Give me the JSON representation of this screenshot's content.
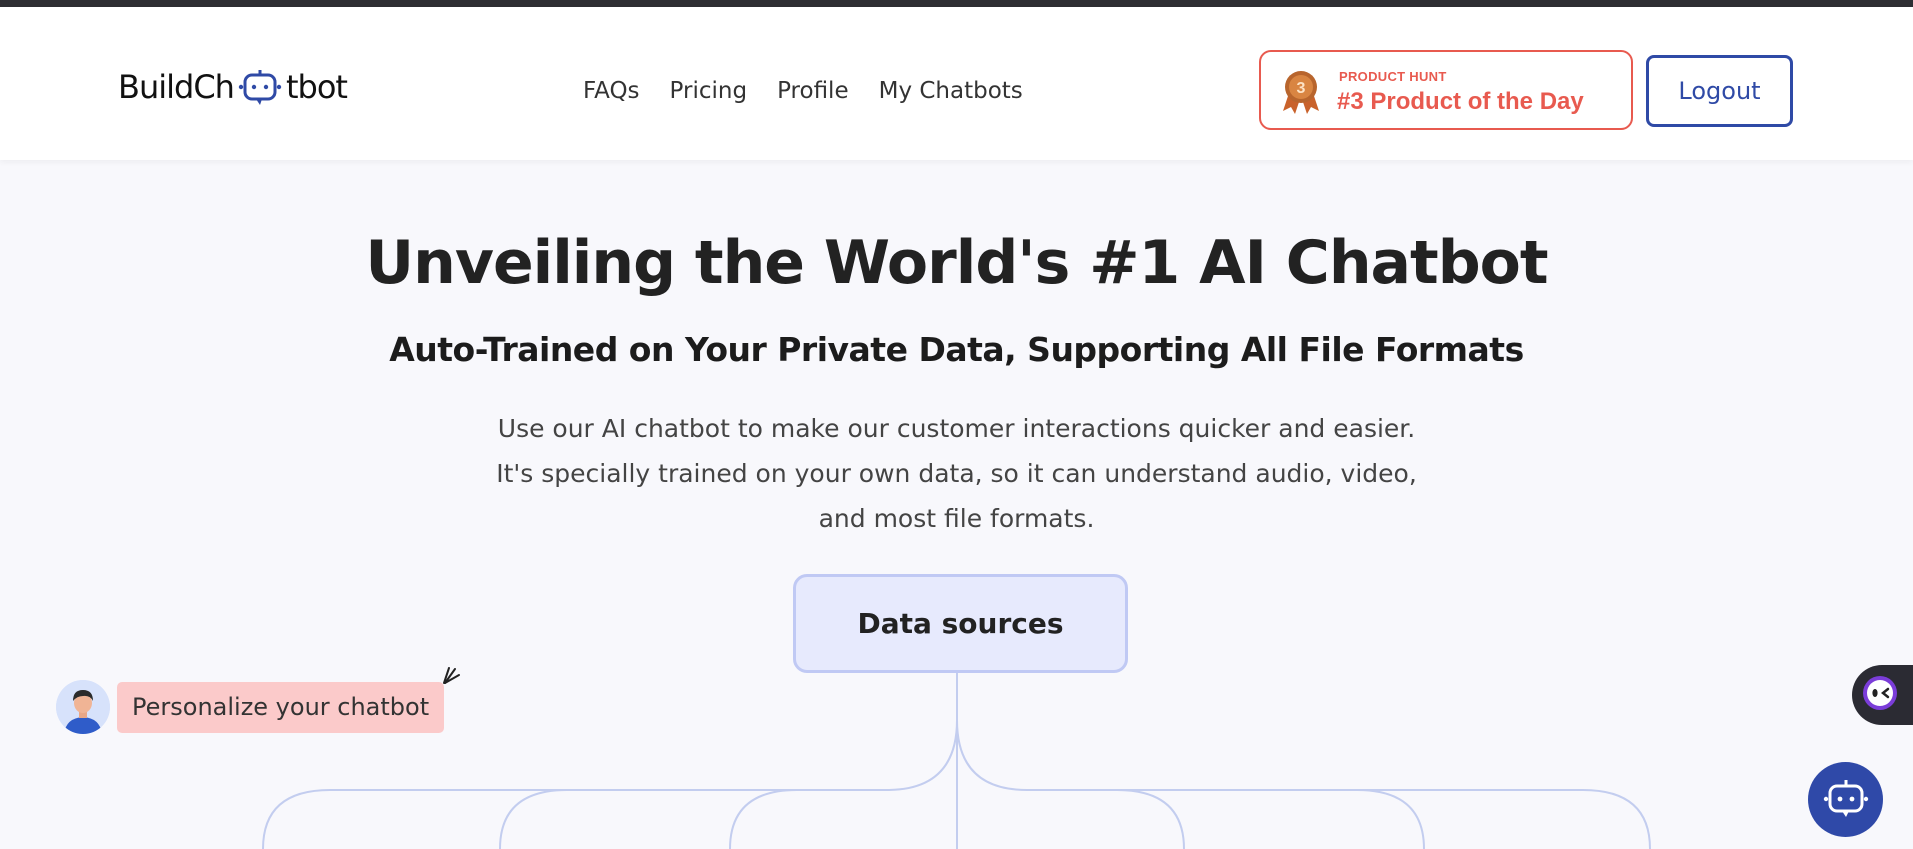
{
  "header": {
    "logo_text_before": "BuildCh",
    "logo_text_after": "tbot",
    "nav": [
      {
        "label": "FAQs"
      },
      {
        "label": "Pricing"
      },
      {
        "label": "Profile"
      },
      {
        "label": "My Chatbots"
      }
    ],
    "product_hunt": {
      "rank_digit": "3",
      "small_label": "PRODUCT HUNT",
      "big_label": "#3 Product of the Day"
    },
    "logout_label": "Logout"
  },
  "hero": {
    "title": "Unveiling the World's #1 AI Chatbot",
    "subtitle": "Auto-Trained on Your Private Data, Supporting All File Formats",
    "description_lines": [
      "Use our AI chatbot to make our customer interactions quicker and easier.",
      "It's specially trained on your own data, so it can understand audio, video,",
      "and most file formats."
    ]
  },
  "diagram": {
    "root_label": "Data sources"
  },
  "personalize": {
    "label": "Personalize your chatbot"
  },
  "colors": {
    "accent_blue": "#2f4aa6",
    "product_hunt_red": "#e85a4f",
    "data_sources_bg": "#e7eafd",
    "personalize_pill": "#fbcaca",
    "page_bg": "#f8f8fc"
  },
  "icons": {
    "logo_mark": "chat-bot-icon",
    "medal": "medal-icon",
    "avatar": "user-avatar-icon",
    "sparkle": "sparkle-icon",
    "side_widget": "bot-face-icon",
    "chat_fab": "chat-bot-icon"
  }
}
